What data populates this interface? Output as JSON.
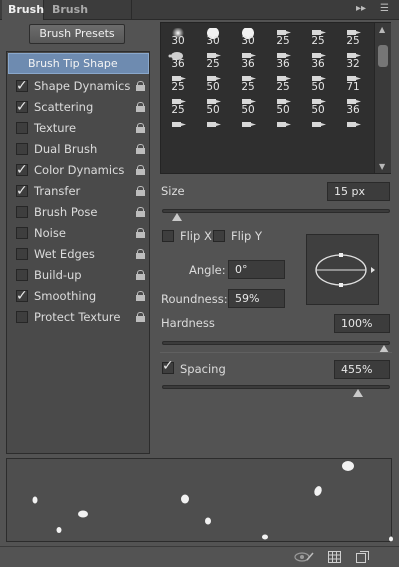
{
  "tabs": [
    {
      "label": "Brush"
    },
    {
      "label": "Brush Presets"
    }
  ],
  "left": {
    "presets_button": "Brush Presets",
    "tip_shape_label": "Brush Tip Shape",
    "options": [
      {
        "label": "Shape Dynamics",
        "checked": true
      },
      {
        "label": "Scattering",
        "checked": true
      },
      {
        "label": "Texture",
        "checked": false
      },
      {
        "label": "Dual Brush",
        "checked": false
      },
      {
        "label": "Color Dynamics",
        "checked": true
      },
      {
        "label": "Transfer",
        "checked": true
      },
      {
        "label": "Brush Pose",
        "checked": false
      },
      {
        "label": "Noise",
        "checked": false
      },
      {
        "label": "Wet Edges",
        "checked": false
      },
      {
        "label": "Build-up",
        "checked": false
      },
      {
        "label": "Smoothing",
        "checked": true
      },
      {
        "label": "Protect Texture",
        "checked": false
      }
    ]
  },
  "brush_sizes": [
    [
      "30",
      "30",
      "30",
      "25",
      "25",
      "25"
    ],
    [
      "36",
      "25",
      "36",
      "36",
      "36",
      "32"
    ],
    [
      "25",
      "50",
      "25",
      "25",
      "50",
      "71"
    ],
    [
      "25",
      "50",
      "50",
      "50",
      "50",
      "36"
    ],
    [
      "",
      "",
      "",
      "",
      "",
      ""
    ]
  ],
  "controls": {
    "size_label": "Size",
    "size_value": "15 px",
    "size_level": 0.04,
    "flip_x_label": "Flip X",
    "flip_y_label": "Flip Y",
    "angle_label": "Angle:",
    "angle_value": "0°",
    "roundness_label": "Roundness:",
    "roundness_value": "59%",
    "hardness_label": "Hardness",
    "hardness_value": "100%",
    "hardness_level": 1.0,
    "spacing_label": "Spacing",
    "spacing_value": "455%",
    "spacing_checked": true,
    "spacing_level": 0.88
  }
}
